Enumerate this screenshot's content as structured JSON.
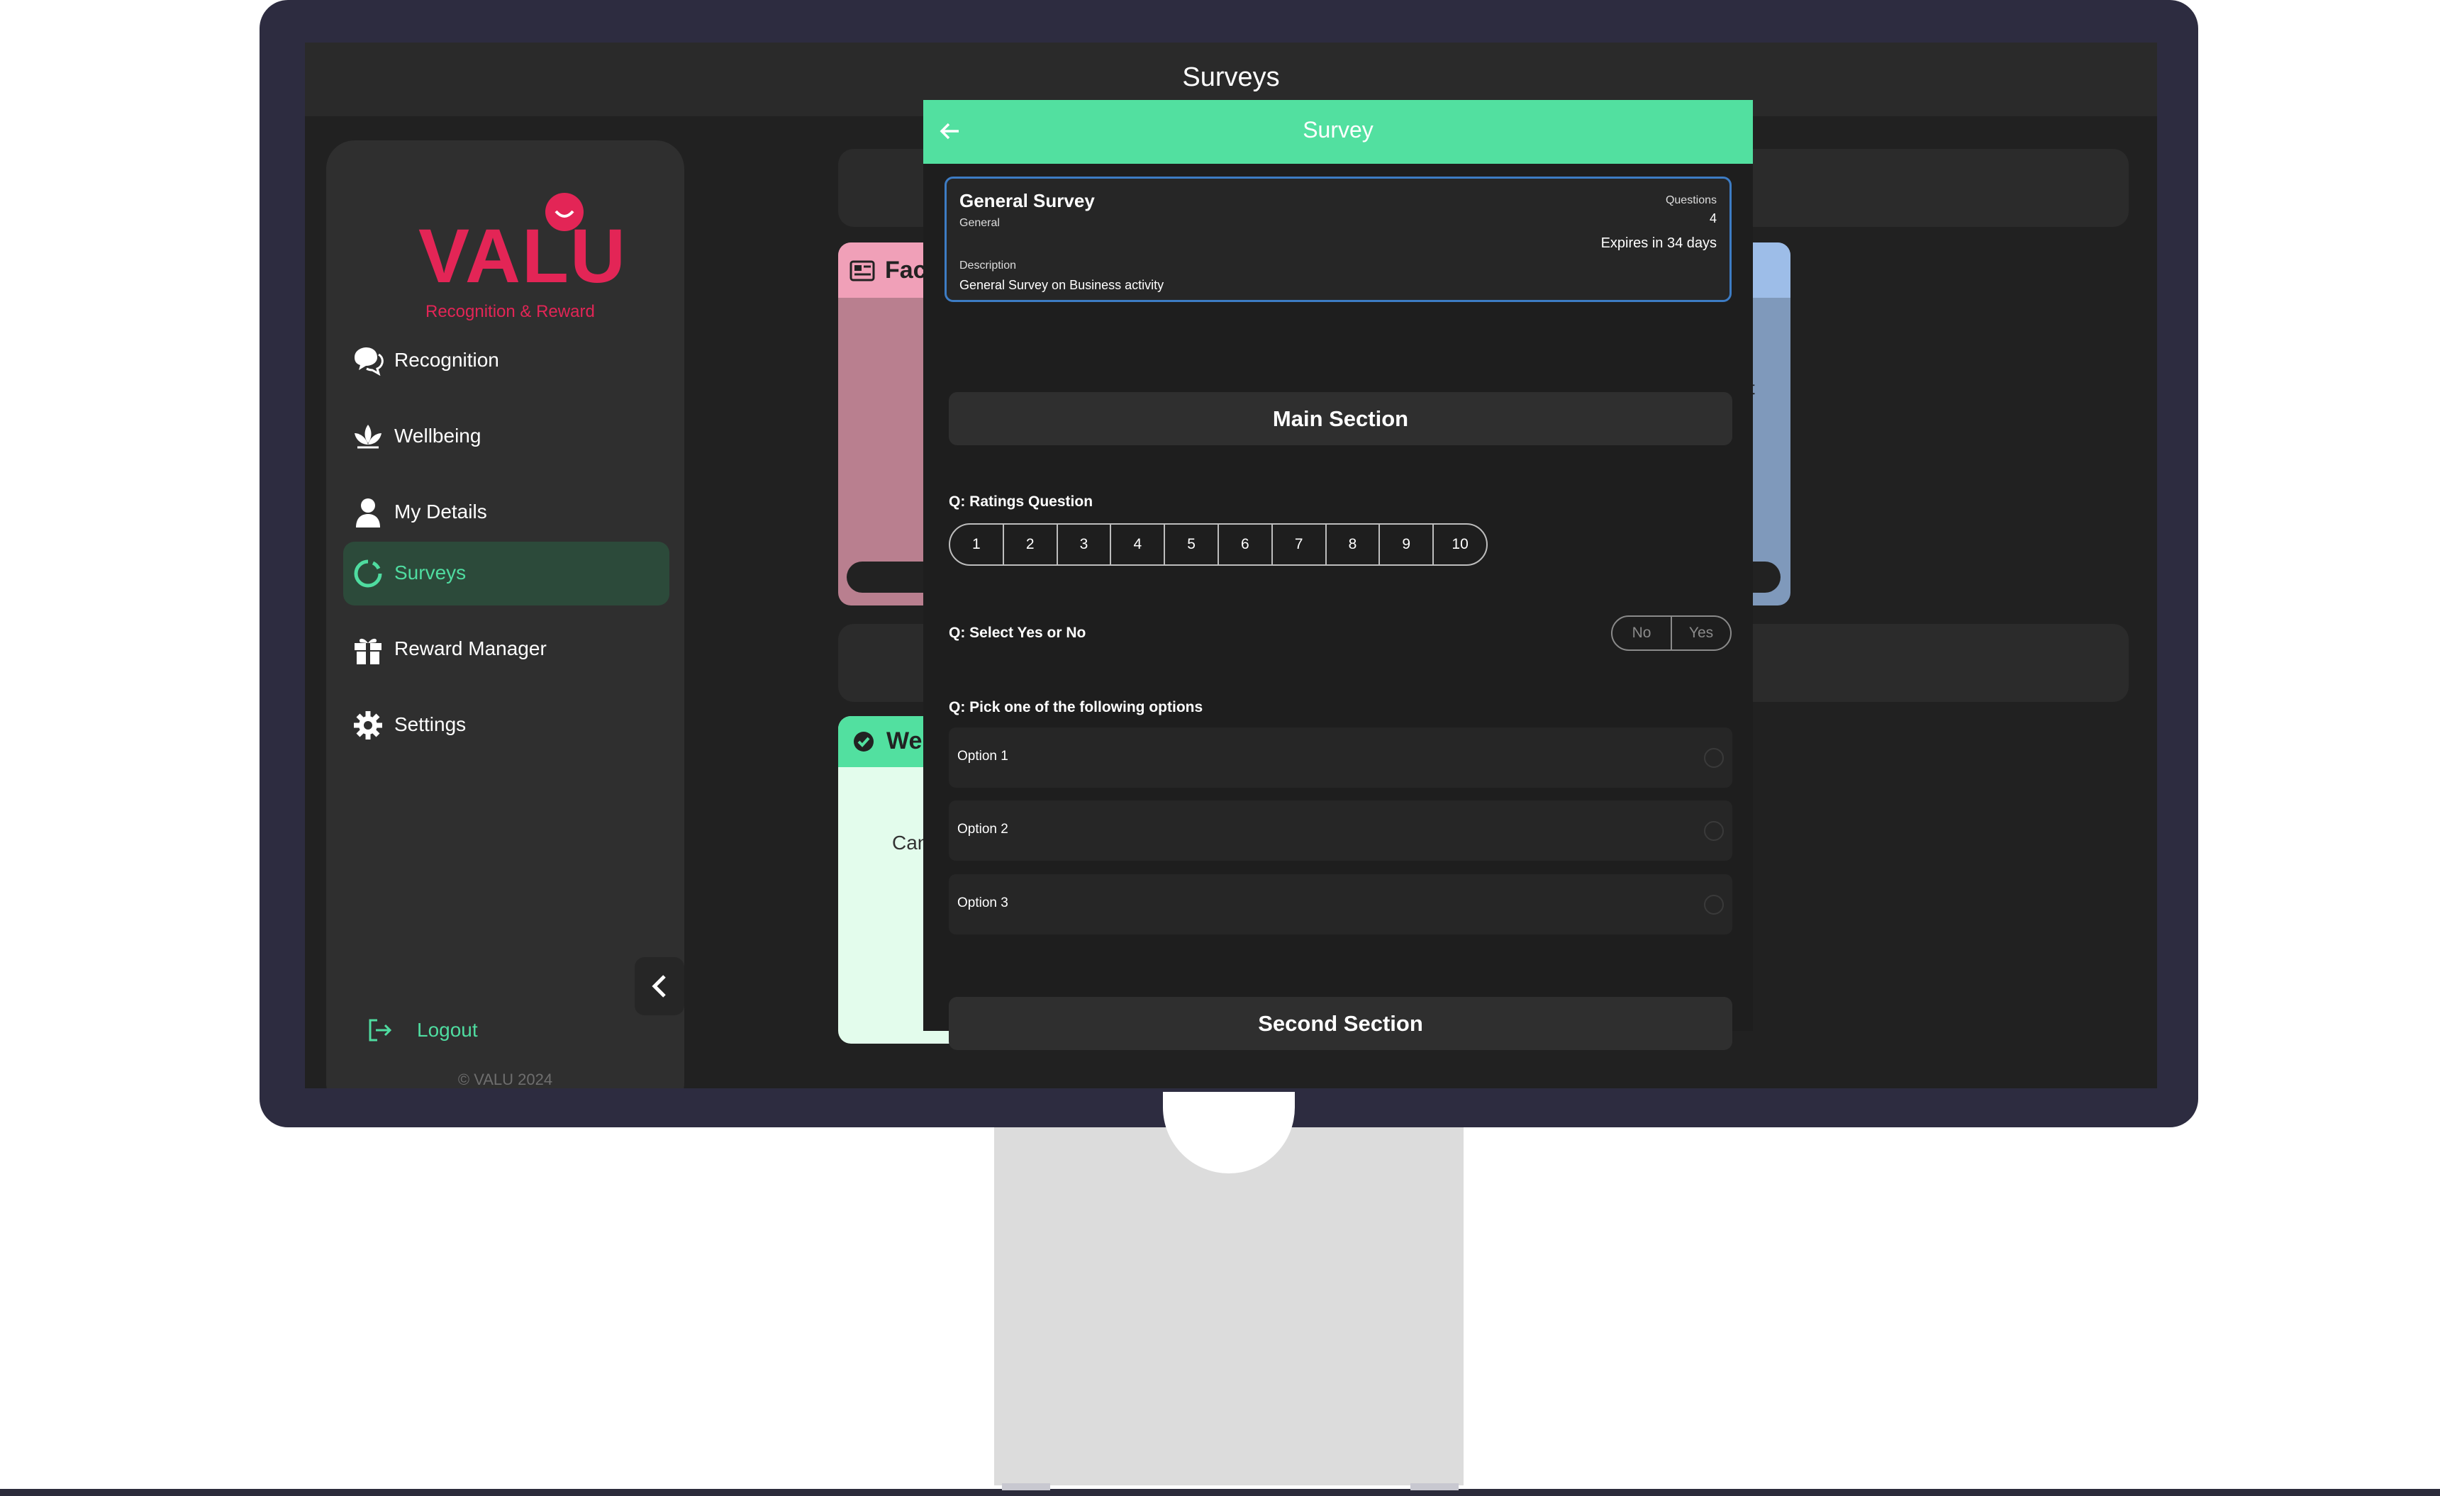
{
  "header": {
    "title": "Surveys"
  },
  "sidebar": {
    "logo": {
      "brand": "VALU",
      "tagline": "Recognition & Reward"
    },
    "items": [
      {
        "label": "Recognition",
        "icon": "chat-bubbles-icon"
      },
      {
        "label": "Wellbeing",
        "icon": "lotus-icon"
      },
      {
        "label": "My Details",
        "icon": "user-icon"
      },
      {
        "label": "Surveys",
        "icon": "surveys-ring-icon",
        "active": true
      },
      {
        "label": "Reward Manager",
        "icon": "gift-icon"
      },
      {
        "label": "Settings",
        "icon": "gear-icon"
      }
    ],
    "logout": "Logout",
    "copyright": "© VALU 2024"
  },
  "background": {
    "card_pink_label": "Fac",
    "card_green_label": "We",
    "card_green_text": "Can",
    "card_blue_text": "nt"
  },
  "modal": {
    "title": "Survey",
    "survey": {
      "name": "General Survey",
      "category": "General",
      "questions_label": "Questions",
      "questions_count": "4",
      "expires": "Expires in 34 days",
      "description_label": "Description",
      "description": "General Survey on Business activity"
    },
    "sections": [
      {
        "title": "Main Section"
      },
      {
        "title": "Second Section"
      }
    ],
    "q_prefix": "Q:",
    "questions": {
      "ratings": {
        "label": "Ratings Question",
        "options": [
          "1",
          "2",
          "3",
          "4",
          "5",
          "6",
          "7",
          "8",
          "9",
          "10"
        ]
      },
      "yesno": {
        "label": "Select Yes or No",
        "no": "No",
        "yes": "Yes"
      },
      "pick": {
        "label": "Pick one of the following options",
        "options": [
          "Option 1",
          "Option 2",
          "Option 3"
        ]
      }
    }
  },
  "colors": {
    "accent_green": "#52e0a0",
    "brand_red": "#e32556",
    "info_border": "#3d7cc4",
    "pink_card": "#f0a0b8",
    "blue_card": "#9dbde8",
    "green_card": "#e3fcec"
  }
}
